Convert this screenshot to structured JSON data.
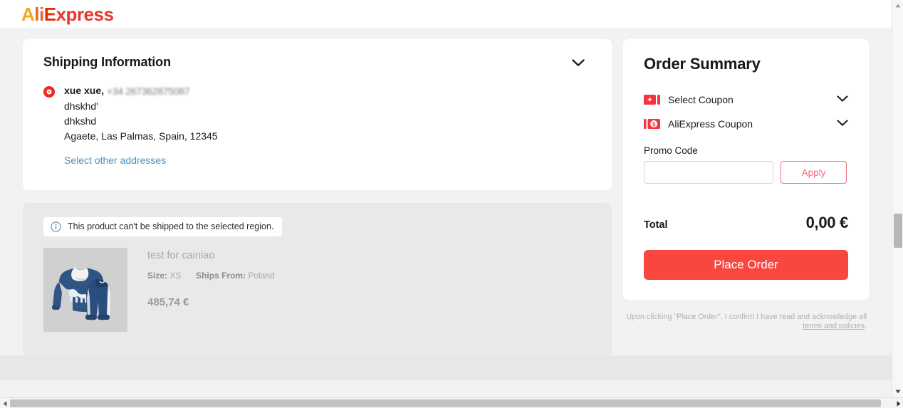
{
  "brand": {
    "logo_parts": [
      "A",
      "li",
      "E",
      "xpress"
    ],
    "accent_orange": "#f5a623",
    "accent_red": "#e8382c"
  },
  "shipping": {
    "title": "Shipping Information",
    "collapse_icon": "chevron-down-icon",
    "address": {
      "name": "xue xue,",
      "phone": "+34 267362875087",
      "line1": "dhskhd'",
      "line2": "dhkshd",
      "line3": "Agaete, Las Palmas, Spain, 12345",
      "selected": true
    },
    "select_other_link": "Select other addresses"
  },
  "product_section": {
    "warning": {
      "icon": "info-circle-icon",
      "text": "This product can't be shipped to the selected region."
    },
    "item": {
      "image_alt": "blue-kids-tracksuit-thumbnail",
      "name": "test for cainiao",
      "size_label": "Size:",
      "size_value": "XS",
      "ships_from_label": "Ships From:",
      "ships_from_value": "Poland",
      "price": "485,74 €"
    }
  },
  "order_summary": {
    "title": "Order Summary",
    "coupons": [
      {
        "icon": "coupon-sparkle-icon",
        "label": "Select Coupon",
        "chevron": "chevron-down-icon"
      },
      {
        "icon": "coupon-dollar-icon",
        "label": "AliExpress Coupon",
        "chevron": "chevron-down-icon"
      }
    ],
    "promo": {
      "label": "Promo Code",
      "value": "",
      "placeholder": "",
      "apply_label": "Apply"
    },
    "total": {
      "label": "Total",
      "value": "0,00 €"
    },
    "place_order_label": "Place Order",
    "place_order_color": "#f9463f",
    "disclaimer": {
      "text": "Upon clicking \"Place Order\", I confirm I have read and acknowledge all ",
      "terms_link": "terms and policies",
      "period": "."
    }
  },
  "scrollbars": {
    "vertical": {
      "up_icon": "triangle-up-icon",
      "down_icon": "triangle-down-icon"
    },
    "horizontal": {
      "left_icon": "triangle-left-icon",
      "right_icon": "triangle-right-icon"
    }
  }
}
